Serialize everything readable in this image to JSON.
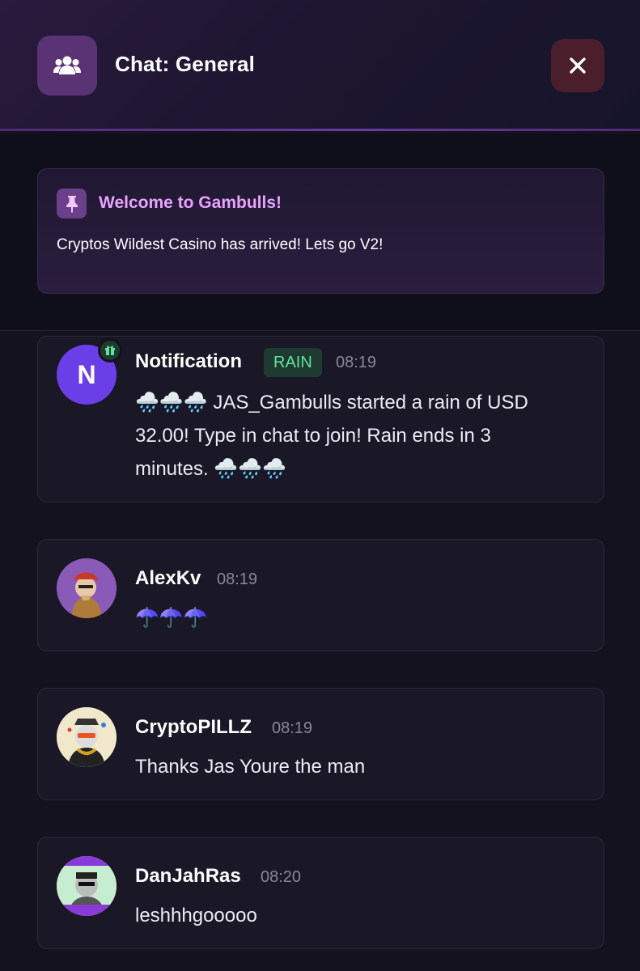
{
  "header": {
    "title": "Chat: General",
    "chat_icon": "users-icon",
    "close_icon": "close-icon"
  },
  "pinned": {
    "icon": "pin-icon",
    "title": "Welcome to Gambulls!",
    "text": "Cryptos Wildest Casino has arrived! Lets go V2!"
  },
  "messages": [
    {
      "username": "Notification",
      "badge": "RAIN",
      "time": "08:19",
      "avatar_letter": "N",
      "line1": "🌧️🌧️🌧️ JAS_Gambulls started a rain of USD",
      "line2": "32.00! Type in chat to join! Rain ends in 3",
      "line3": "minutes. 🌧️🌧️🌧️"
    },
    {
      "username": "AlexKv",
      "time": "08:19",
      "text": "☂️☂️☂️"
    },
    {
      "username": "CryptoPILLZ",
      "time": "08:19",
      "text": "Thanks Jas Youre the man"
    },
    {
      "username": "DanJahRas",
      "time": "08:20",
      "text": "leshhhgooooo"
    }
  ],
  "colors": {
    "accent_pink": "#e9a3ff",
    "rain_green": "#5fe3a1",
    "close_bg": "#4a1e2a"
  }
}
